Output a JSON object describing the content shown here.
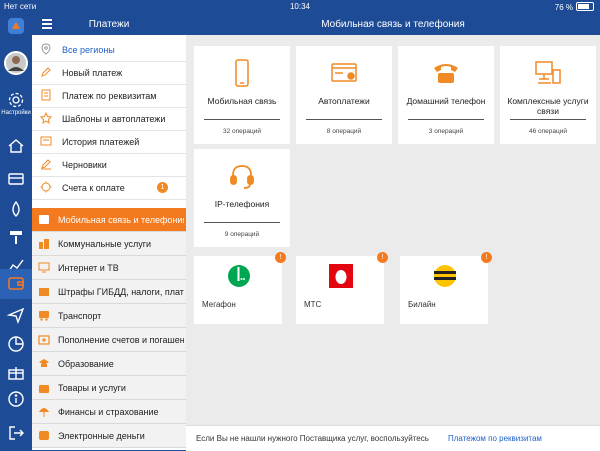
{
  "status_bar": {
    "carrier": "Нет сети",
    "time": "10:34",
    "battery": "76 %"
  },
  "rail": {
    "settings_label": "Настройки",
    "icons": [
      "logo-icon",
      "avatar",
      "settings-gear-icon",
      "home-icon",
      "card-icon",
      "drop-icon",
      "paint-roller-icon",
      "chart-icon",
      "wallet-icon",
      "send-icon",
      "pie-chart-icon",
      "gift-icon",
      "info-icon",
      "logout-icon"
    ]
  },
  "menu": {
    "title": "Платежи",
    "items": [
      {
        "label": "Все регионы",
        "icon": "location-pin-icon",
        "accent": true
      },
      {
        "label": "Новый платеж",
        "icon": "pencil-icon"
      },
      {
        "label": "Платеж по реквизитам",
        "icon": "document-icon"
      },
      {
        "label": "Шаблоны и автоплатежи",
        "icon": "star-icon"
      },
      {
        "label": "История платежей",
        "icon": "history-icon"
      },
      {
        "label": "Черновики",
        "icon": "drafts-icon"
      },
      {
        "label": "Счета к оплате",
        "icon": "bell-icon",
        "badge": "1"
      }
    ],
    "categories": [
      {
        "label": "Мобильная связь и телефония",
        "active": true
      },
      {
        "label": "Коммунальные услуги"
      },
      {
        "label": "Интернет и ТВ"
      },
      {
        "label": "Штрафы ГИБДД, налоги, плате..."
      },
      {
        "label": "Транспорт"
      },
      {
        "label": "Пополнение счетов и погашен..."
      },
      {
        "label": "Образование"
      },
      {
        "label": "Товары и услуги"
      },
      {
        "label": "Финансы и страхование"
      },
      {
        "label": "Электронные деньги"
      }
    ]
  },
  "main": {
    "title": "Мобильная связь и телефония",
    "cards": [
      {
        "label": "Мобильная связь",
        "count": "32 операций",
        "icon": "mobile-phone-icon"
      },
      {
        "label": "Автоплатежи",
        "count": "8 операций",
        "icon": "autopay-icon"
      },
      {
        "label": "Домашний телефон",
        "count": "3 операций",
        "icon": "landline-phone-icon"
      },
      {
        "label": "Комплексные услуги связи",
        "count": "46 операций",
        "icon": "complex-services-icon"
      },
      {
        "label": "IP-телефония",
        "count": "9 операций",
        "icon": "headset-icon"
      }
    ],
    "providers": [
      {
        "name": "Мегафон",
        "badge": "!"
      },
      {
        "name": "МТС",
        "badge": "!"
      },
      {
        "name": "Билайн",
        "badge": "!"
      }
    ],
    "footer": {
      "hint": "Если Вы не нашли нужного Поставщика услуг, воспользуйтесь",
      "link": "Платежом по реквизитам"
    }
  },
  "colors": {
    "brand_blue": "#1e4b96",
    "accent_orange": "#f47a20",
    "background": "#ebebeb",
    "link_blue": "#1e5fc8",
    "megafon_green": "#00a651",
    "mts_red": "#e30611",
    "beeline_yellow": "#ffc400"
  }
}
